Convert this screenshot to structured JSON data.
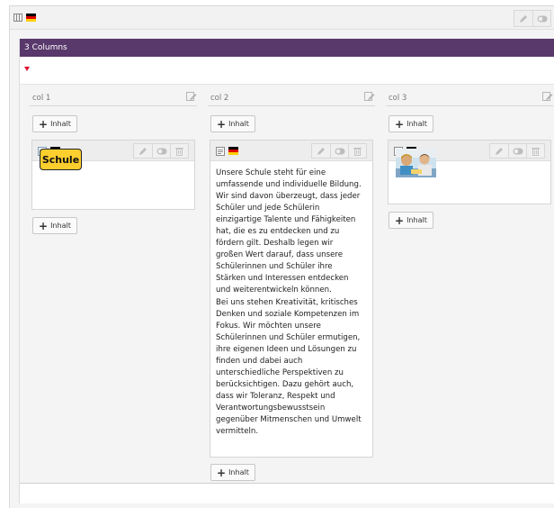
{
  "container": {
    "title": "3 Columns"
  },
  "add_label": "Inhalt",
  "columns": [
    {
      "label": "col 1"
    },
    {
      "label": "col 2"
    },
    {
      "label": "col 3"
    }
  ],
  "cards": {
    "col1": {
      "image_text": "Schule"
    },
    "col2": {
      "text": "Unsere Schule steht für eine\numfassende und individuelle Bildung.\nWir sind davon überzeugt, dass jeder\nSchüler und jede Schülerin\neinzigartige Talente und Fähigkeiten\nhat, die es zu entdecken und zu\nfördern gilt. Deshalb legen wir\ngroßen Wert darauf, dass unsere\nSchülerinnen und Schüler ihre\nStärken und Interessen entdecken\nund weiterentwickeln können.\nBei uns stehen Kreativität, kritisches\nDenken und soziale Kompetenzen im\nFokus. Wir möchten unsere\nSchülerinnen und Schüler ermutigen,\nihre eigenen Ideen und Lösungen zu\nfinden und dabei auch\nunterschiedliche Perspektiven zu\nberücksichtigen. Dazu gehört auch,\ndass wir Toleranz, Respekt und\nVerantwortungsbewusstsein\ngegenüber Mitmenschen und Umwelt\nvermitteln."
    },
    "col3": {
      "image": "children-learning-photo"
    }
  },
  "icons": {
    "grid": "grid-layout-icon",
    "flag": "german-flag-icon",
    "edit": "pencil-icon",
    "toggle": "visibility-toggle-icon",
    "delete": "trash-icon",
    "image_type": "image-content-icon",
    "text_type": "text-content-icon",
    "textpic_type": "text-image-content-icon",
    "column_edit": "column-edit-icon"
  },
  "colors": {
    "container_header": "#59386b",
    "caret": "#dd1133",
    "sign_yellow": "#fcce2e"
  }
}
